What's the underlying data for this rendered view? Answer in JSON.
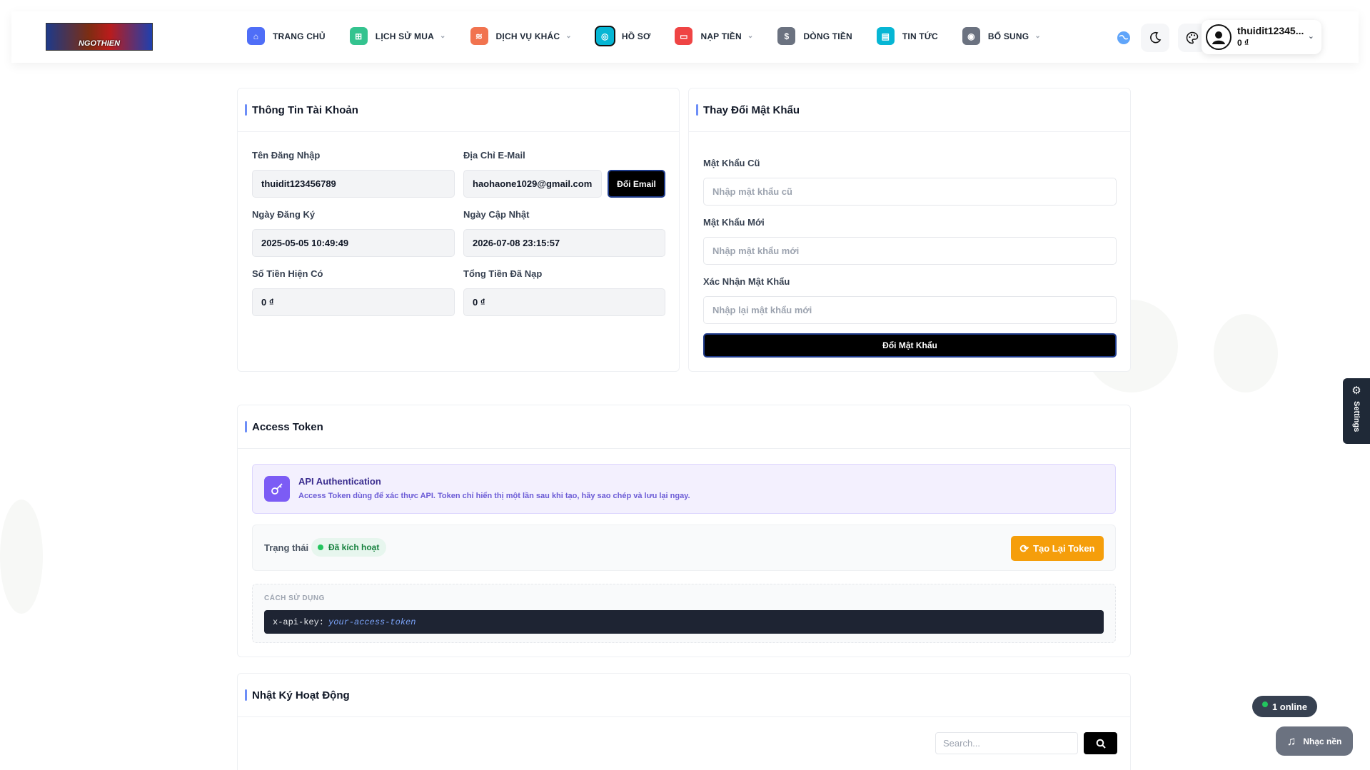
{
  "header": {
    "logo_text": "NGOTHIEN",
    "nav": [
      {
        "label": "TRANG CHỦ",
        "icon": "home-icon",
        "color": "#4f6ef7",
        "glyph": "⌂",
        "chevron": false
      },
      {
        "label": "LỊCH SỬ MUA",
        "icon": "gamepad-icon",
        "color": "#34c38f",
        "glyph": "⊞",
        "chevron": true
      },
      {
        "label": "DỊCH VỤ KHÁC",
        "icon": "layers-icon",
        "color": "#f1734f",
        "glyph": "≋",
        "chevron": true
      },
      {
        "label": "HỒ SƠ",
        "icon": "profile-icon",
        "color": "#06b6d4",
        "glyph": "◎",
        "chevron": false
      },
      {
        "label": "NẠP TIỀN",
        "icon": "wallet-icon",
        "color": "#ef4444",
        "glyph": "▭",
        "chevron": true
      },
      {
        "label": "DÒNG TIỀN",
        "icon": "dollar-icon",
        "color": "#6b7280",
        "glyph": "$",
        "chevron": false
      },
      {
        "label": "TIN TỨC",
        "icon": "news-icon",
        "color": "#06b6d4",
        "glyph": "▤",
        "chevron": false
      },
      {
        "label": "BỔ SUNG",
        "icon": "plus-circle-icon",
        "color": "#6b7280",
        "glyph": "◉",
        "chevron": true
      }
    ],
    "user_name": "thuidit12345...",
    "user_balance": "0 ₫"
  },
  "account": {
    "title": "Thông Tin Tài Khoản",
    "username_label": "Tên Đăng Nhập",
    "username_value": "thuidit123456789",
    "email_label": "Địa Chỉ E-Mail",
    "email_value": "haohaone1029@gmail.com",
    "change_email_button": "Đổi Email",
    "register_label": "Ngày Đăng Ký",
    "register_value": "2025-05-05 10:49:49",
    "updated_label": "Ngày Cập Nhật",
    "updated_value": "2026-07-08 23:15:57",
    "balance_label": "Số Tiền Hiện Có",
    "balance_value": "0 ₫",
    "total_label": "Tổng Tiền Đã Nạp",
    "total_value": "0 ₫"
  },
  "password": {
    "title": "Thay Đổi Mật Khẩu",
    "old_label": "Mật Khẩu Cũ",
    "old_placeholder": "Nhập mật khẩu cũ",
    "new_label": "Mật Khẩu Mới",
    "new_placeholder": "Nhập mật khẩu mới",
    "confirm_label": "Xác Nhận Mật Khẩu",
    "confirm_placeholder": "Nhập lại mật khẩu mới",
    "submit_button": "Đổi Mật Khẩu"
  },
  "token": {
    "title": "Access Token",
    "api_title": "API Authentication",
    "api_desc": "Access Token dùng để xác thực API. Token chỉ hiển thị một lần sau khi tạo, hãy sao chép và lưu lại ngay.",
    "status_label": "Trạng thái",
    "status_value": "Đã kích hoạt",
    "regen_button": "Tạo Lại Token",
    "usage_label": "CÁCH SỬ DỤNG",
    "code_key": "x-api-key:",
    "code_value": "your-access-token"
  },
  "activity": {
    "title": "Nhật Ký Hoạt Động",
    "search_placeholder": "Search..."
  },
  "widgets": {
    "settings_label": "Settings",
    "online_text": "1 online",
    "music_label": "Nhạc nền"
  }
}
